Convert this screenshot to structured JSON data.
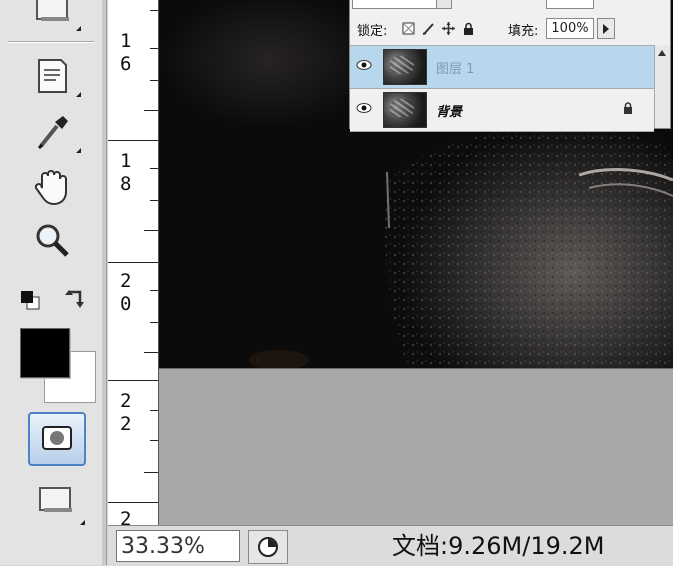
{
  "ruler": {
    "labels": [
      "1\n6",
      "1\n8",
      "2\n0",
      "2\n2",
      "2"
    ]
  },
  "layers_panel": {
    "lock_label": "锁定:",
    "fill_label": "填充:",
    "fill_value": "100%",
    "layers": [
      {
        "name": "图层 1",
        "selected": true
      },
      {
        "name": "背景",
        "selected": false,
        "locked": true
      }
    ]
  },
  "status_bar": {
    "zoom": "33.33%",
    "doc_info": "文档:9.26M/19.2M"
  },
  "toolbox": {
    "tools": [
      "rectangle-tool-icon",
      "notes-tool-icon",
      "eyedropper-tool-icon",
      "hand-tool-icon",
      "zoom-tool-icon",
      "default-colors-icon",
      "swap-colors-icon",
      "quick-mask-icon",
      "screen-mode-icon"
    ],
    "foreground_color": "#000000",
    "background_color": "#ffffff"
  },
  "colors": {
    "selected_layer": "#b6d7ec",
    "canvas_bg": "#a6a8aa"
  }
}
